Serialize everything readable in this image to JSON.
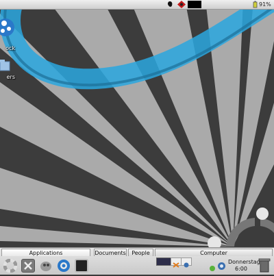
{
  "top_panel": {
    "battery": "91%",
    "icons": [
      "gnome-foot-icon",
      "network-icon",
      "black-applet"
    ]
  },
  "desktop": {
    "icons": [
      {
        "name": "home-icon",
        "label": "ock"
      },
      {
        "name": "folder-icon",
        "label": "ers"
      }
    ]
  },
  "bottom_panel": {
    "tabs": [
      "Applications",
      "Documents",
      "People",
      "Computer"
    ],
    "launchers": [
      "lifesaver-icon",
      "x-tools-icon",
      "gimp-icon",
      "browser-icon",
      "terminal-icon"
    ],
    "clock": {
      "day": "Donnerstag",
      "time": "6:00"
    }
  },
  "colors": {
    "accent": "#2aa7df",
    "panel": "#dcdcdc"
  }
}
